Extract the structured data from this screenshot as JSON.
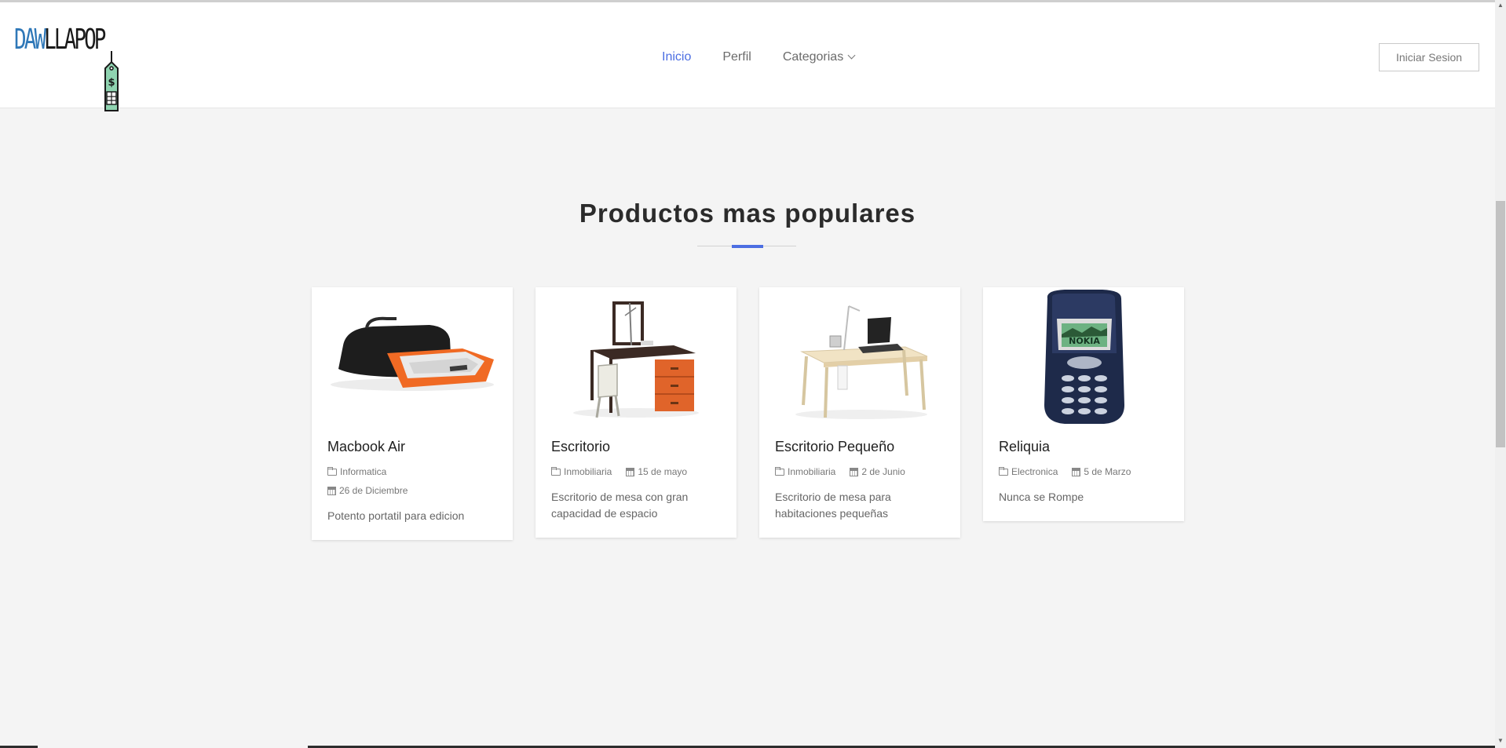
{
  "header": {
    "logo": {
      "part_a": "DAW",
      "part_b": "LLAPOP",
      "tag_symbol": "$"
    },
    "nav": [
      {
        "label": "Inicio",
        "active": true
      },
      {
        "label": "Perfil",
        "active": false
      },
      {
        "label": "Categorias",
        "active": false,
        "has_dropdown": true
      }
    ],
    "login_label": "Iniciar Sesion"
  },
  "section": {
    "title": "Productos mas populares"
  },
  "products": [
    {
      "title": "Macbook Air",
      "category": "Informatica",
      "date": "26 de Diciembre",
      "description": "Potento portatil para edicion",
      "image": "laptop-bag"
    },
    {
      "title": "Escritorio",
      "category": "Inmobiliaria",
      "date": "15 de mayo",
      "description": "Escritorio de mesa con gran capacidad de espacio",
      "image": "desk"
    },
    {
      "title": "Escritorio Pequeño",
      "category": "Inmobiliaria",
      "date": "2 de Junio",
      "description": "Escritorio de mesa para habitaciones pequeñas",
      "image": "small-desk"
    },
    {
      "title": "Reliquia",
      "category": "Electronica",
      "date": "5 de Marzo",
      "description": "Nunca se Rompe",
      "image": "nokia-phone",
      "phone_brand": "NOKIA"
    }
  ],
  "colors": {
    "accent": "#4c6ee2",
    "logo_blue": "#2f78b8",
    "tag_green": "#8fd3b0",
    "background": "#f4f4f4"
  }
}
